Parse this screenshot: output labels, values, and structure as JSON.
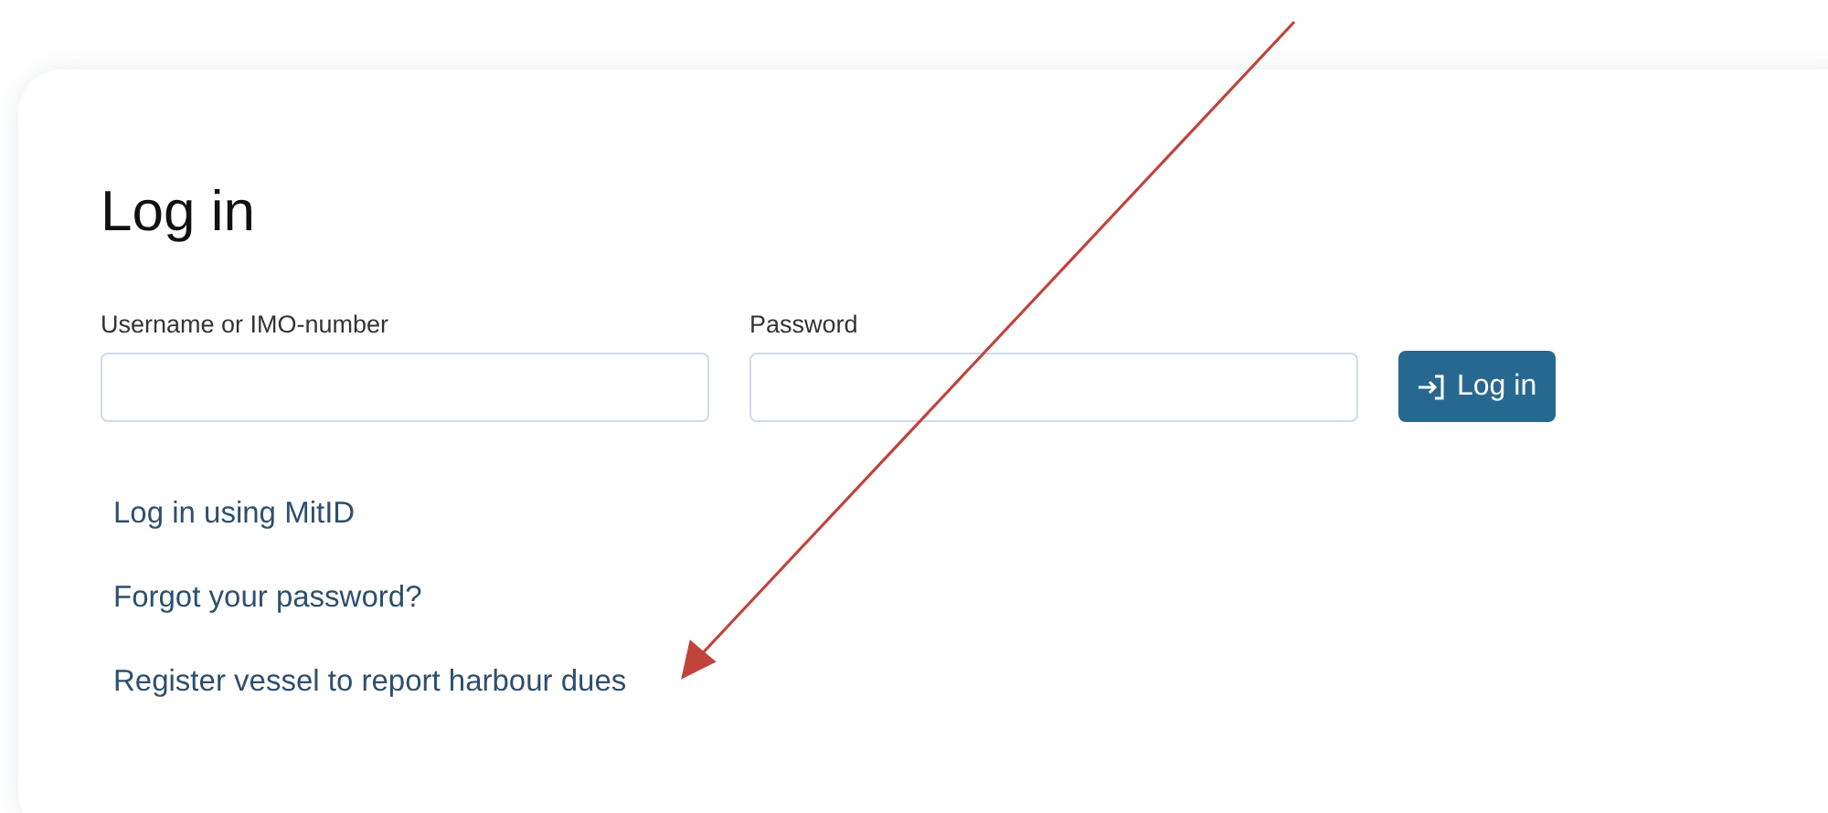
{
  "login": {
    "title": "Log in",
    "fields": [
      {
        "label": "Username or IMO-number"
      },
      {
        "label": "Password"
      }
    ],
    "submit": {
      "label": "Log in"
    },
    "links": [
      "Log in using MitID",
      "Forgot your password?",
      "Register vessel to report harbour dues"
    ]
  }
}
